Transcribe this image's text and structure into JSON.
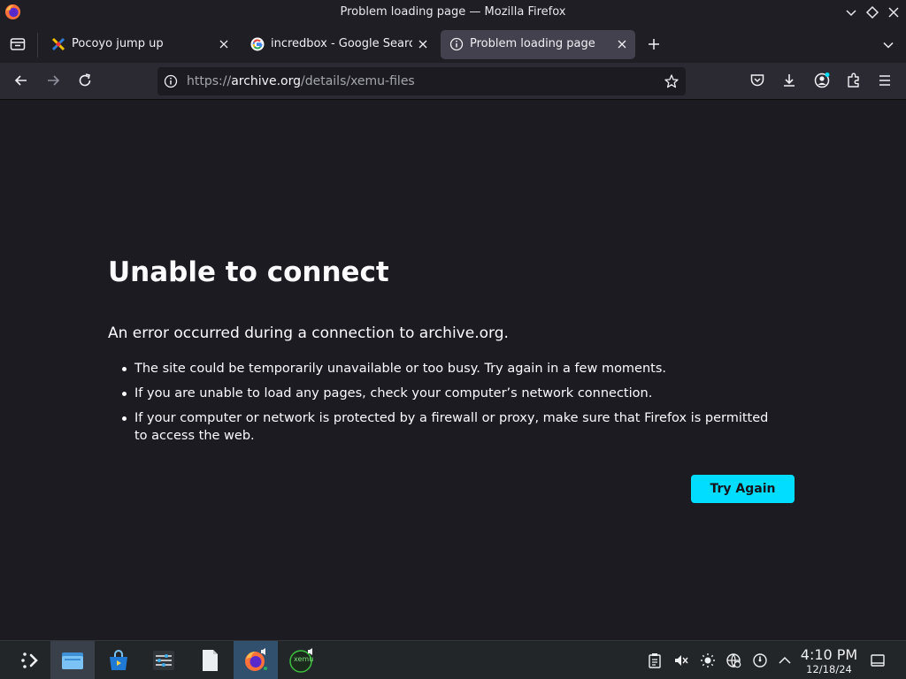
{
  "window": {
    "title": "Problem loading page — Mozilla Firefox"
  },
  "tabs": [
    {
      "label": "Pocoyo jump up",
      "favicon": "pocoyo-favicon",
      "active": false
    },
    {
      "label": "incredbox - Google Search",
      "favicon": "google-favicon",
      "active": false
    },
    {
      "label": "Problem loading page",
      "favicon": "info-icon",
      "active": true
    }
  ],
  "urlbar": {
    "scheme_prefix": "https://",
    "host": "archive.org",
    "path": "/details/xemu-files"
  },
  "error": {
    "title": "Unable to connect",
    "intro": "An error occurred during a connection to archive.org.",
    "bullets": [
      "The site could be temporarily unavailable or too busy. Try again in a few moments.",
      "If you are unable to load any pages, check your computer’s network connection.",
      "If your computer or network is protected by a firewall or proxy, make sure that Firefox is permitted to access the web."
    ],
    "button_label": "Try Again"
  },
  "taskbar": {
    "apps": [
      "application-launcher-icon",
      "files-icon",
      "store-icon",
      "settings-icon",
      "document-icon",
      "firefox-icon",
      "xemu-icon"
    ],
    "xemu_label": "xemu"
  },
  "clock": {
    "time": "4:10 PM",
    "date": "12/18/24"
  },
  "colors": {
    "accent": "#00ddff",
    "background": "#1c1b22",
    "toolbar": "#2b2a33",
    "taskbar": "#232629"
  }
}
